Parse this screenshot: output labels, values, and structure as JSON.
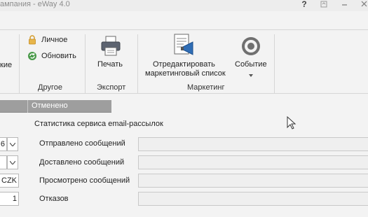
{
  "window": {
    "title": "ампания - eWay 4.0",
    "help": "?"
  },
  "ribbon": {
    "partial_left_label": "кие",
    "lichnoe": "Личное",
    "obnovit": "Обновить",
    "group_other": "Другое",
    "pechat": "Печать",
    "group_export": "Экспорт",
    "edit_list_line1": "Отредактировать",
    "edit_list_line2": "маркетинговый список",
    "sobytie": "Событие",
    "group_marketing": "Маркетинг"
  },
  "grid": {
    "column": "Отменено"
  },
  "stats": {
    "title": "Статистика сервиса email-рассылок",
    "sent_label": "Отправлено сообщений",
    "delivered_label": "Доставлено сообщений",
    "viewed_label": "Просмотрено сообщений",
    "rejected_label": "Отказов"
  },
  "left_fields": {
    "f1": "6",
    "f3": "CZK",
    "f4": "1"
  },
  "colors": {
    "accent_blue": "#2f6db5",
    "grid_header": "#9e9e9e"
  }
}
